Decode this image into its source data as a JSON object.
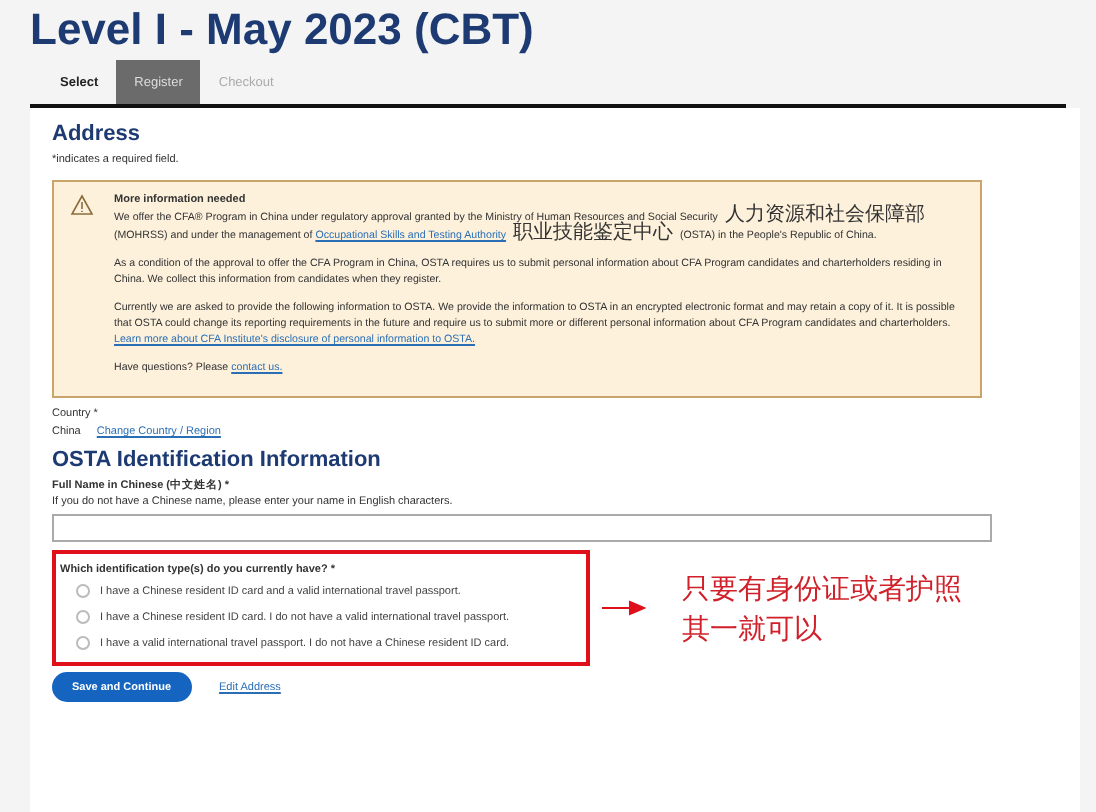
{
  "page_title": "Level I - May 2023 (CBT)",
  "steps": [
    {
      "label": "Select",
      "selected": false
    },
    {
      "label": "Register",
      "selected": true
    },
    {
      "label": "Checkout",
      "selected": false
    }
  ],
  "section_title": "Address",
  "required_note": "*indicates a required field.",
  "notice": {
    "title": "More information needed",
    "paragraphs": [
      [
        {
          "kind": "text",
          "text": "We offer the CFA® Program in China under regulatory approval granted by the Ministry of Human Resources and Social Security 人力资源和社会保障部 (MOHRSS) and under the management of "
        },
        {
          "kind": "link",
          "text": "Occupational Skills and Testing Authority"
        },
        {
          "kind": "text",
          "text": " 职业技能鉴定中心 (OSTA) in the People's Republic of China."
        }
      ],
      [
        {
          "kind": "text",
          "text": "As a condition of the approval to offer the CFA Program in China, OSTA requires us to submit personal information about CFA Program candidates and charterholders residing in China. We collect this information from candidates when they register."
        }
      ],
      [
        {
          "kind": "text",
          "text": "Currently we are asked to provide the following information to OSTA. We provide the information to OSTA in an encrypted electronic format and may retain a copy of it. It is possible that OSTA could change its reporting requirements in the future and require us to submit more or different personal information about CFA Program candidates and charterholders. "
        },
        {
          "kind": "link",
          "text": "Learn more about CFA Institute's disclosure of personal information to OSTA."
        }
      ],
      [
        {
          "kind": "text",
          "text": "Have questions? Please "
        },
        {
          "kind": "link",
          "text": "contact us."
        }
      ]
    ]
  },
  "country": {
    "label": "Country *",
    "value": "China",
    "change_link": "Change Country / Region"
  },
  "osta_title": "OSTA Identification Information",
  "name_field": {
    "label": "Full Name in Chinese (中文姓名) *",
    "hint": "If you do not have a Chinese name, please enter your name in English characters."
  },
  "id_question": {
    "label": "Which identification type(s) do you currently have? *",
    "options": [
      {
        "label": "I have a Chinese resident ID card and a valid international travel passport.",
        "selected": false
      },
      {
        "label": "I have a Chinese resident ID card. I do not have a valid international travel passport.",
        "selected": false
      },
      {
        "label": "I have a valid international travel passport. I do not have a Chinese resident ID card.",
        "selected": false
      }
    ]
  },
  "annotation": [
    "只要有身份证或者护照",
    "其一就可以"
  ],
  "save_button": "Save and Continue",
  "edit_link": "Edit Address"
}
